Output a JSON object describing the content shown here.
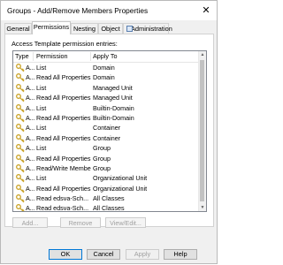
{
  "window": {
    "title": "Groups - Add/Remove Members Properties",
    "close_glyph": "✕"
  },
  "tabs": [
    {
      "label": "General",
      "active": false
    },
    {
      "label": "Permissions",
      "active": true
    },
    {
      "label": "Nesting",
      "active": false
    },
    {
      "label": "Object",
      "active": false
    },
    {
      "label": "Administration",
      "active": false
    }
  ],
  "permissions": {
    "section_label": "Access Template permission entries:",
    "columns": {
      "type": "Type",
      "permission": "Permission",
      "apply_to": "Apply To"
    },
    "rows": [
      {
        "icon": "key-icon",
        "type": "A...",
        "permission": "List",
        "apply_to": "Domain"
      },
      {
        "icon": "key-icon",
        "type": "A...",
        "permission": "Read All Properties",
        "apply_to": "Domain"
      },
      {
        "icon": "key-icon",
        "type": "A...",
        "permission": "List",
        "apply_to": "Managed Unit"
      },
      {
        "icon": "key-icon",
        "type": "A...",
        "permission": "Read All Properties",
        "apply_to": "Managed Unit"
      },
      {
        "icon": "key-icon",
        "type": "A...",
        "permission": "List",
        "apply_to": "Builtin-Domain"
      },
      {
        "icon": "key-icon",
        "type": "A...",
        "permission": "Read All Properties",
        "apply_to": "Builtin-Domain"
      },
      {
        "icon": "key-icon",
        "type": "A...",
        "permission": "List",
        "apply_to": "Container"
      },
      {
        "icon": "key-icon",
        "type": "A...",
        "permission": "Read All Properties",
        "apply_to": "Container"
      },
      {
        "icon": "key-icon",
        "type": "A...",
        "permission": "List",
        "apply_to": "Group"
      },
      {
        "icon": "key-icon",
        "type": "A...",
        "permission": "Read All Properties",
        "apply_to": "Group"
      },
      {
        "icon": "key-icon",
        "type": "A...",
        "permission": "Read/Write Membe...",
        "apply_to": "Group"
      },
      {
        "icon": "key-icon",
        "type": "A...",
        "permission": "List",
        "apply_to": "Organizational Unit"
      },
      {
        "icon": "key-icon",
        "type": "A...",
        "permission": "Read All Properties",
        "apply_to": "Organizational Unit"
      },
      {
        "icon": "key-icon",
        "type": "A...",
        "permission": "Read edsva-Sch...",
        "apply_to": "All Classes"
      },
      {
        "icon": "key-icon",
        "type": "A...",
        "permission": "Read edsva-Sch...",
        "apply_to": "All Classes"
      }
    ],
    "buttons": {
      "add": "Add...",
      "remove": "Remove",
      "view_edit": "View/Edit..."
    }
  },
  "dialog_buttons": {
    "ok": "OK",
    "cancel": "Cancel",
    "apply": "Apply",
    "help": "Help"
  },
  "colors": {
    "accent": "#0078d7",
    "key_gold": "#c9a227"
  }
}
